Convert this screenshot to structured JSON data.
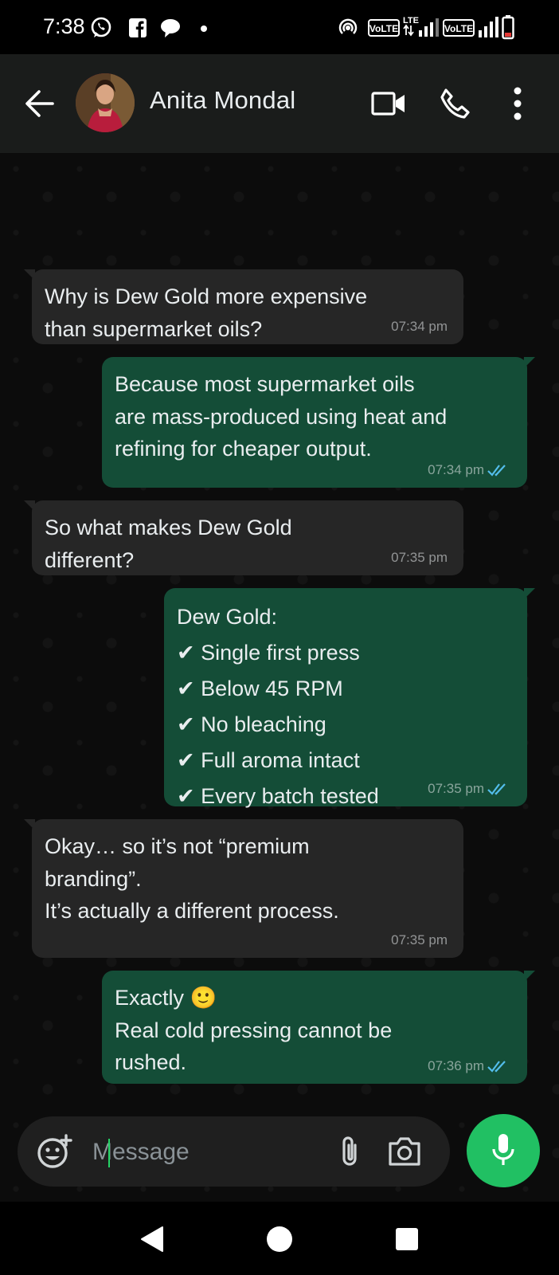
{
  "status_bar": {
    "time": "7:38",
    "left_icons": [
      "whatsapp-icon",
      "facebook-icon",
      "chat-bubble-icon",
      "dot-icon"
    ],
    "right_icons": [
      "hotspot-icon",
      "volte-1-icon",
      "lte-signal-icon",
      "volte-2-icon",
      "signal-icon",
      "battery-icon"
    ],
    "volte_label": "VoLTE",
    "lte_label": "LTE"
  },
  "header": {
    "contact_name": "Anita Mondal",
    "icons": [
      "back-arrow-icon",
      "avatar",
      "video-call-icon",
      "voice-call-icon",
      "more-options-icon"
    ]
  },
  "messages": [
    {
      "direction": "incoming",
      "text": "Why is Dew Gold more expensive\nthan supermarket oils?",
      "time": "07:34 pm"
    },
    {
      "direction": "outgoing",
      "text": "Because most supermarket oils\nare mass-produced using heat and\nrefining for cheaper output.",
      "time": "07:34 pm",
      "status": "read"
    },
    {
      "direction": "incoming",
      "text": "So what makes Dew Gold\ndifferent?",
      "time": "07:35 pm"
    },
    {
      "direction": "outgoing",
      "text": "Dew Gold:\n✔ Single first press\n✔ Below 45 RPM\n✔ No bleaching\n✔ Full aroma intact\n✔ Every batch tested",
      "time": "07:35 pm",
      "status": "read"
    },
    {
      "direction": "incoming",
      "text": "Okay… so it’s not “premium\nbranding”.\nIt’s actually a different process.",
      "time": "07:35 pm"
    },
    {
      "direction": "outgoing",
      "text": "Exactly 🙂\nReal cold pressing cannot be\nrushed.",
      "time": "07:36 pm",
      "status": "read"
    }
  ],
  "composer": {
    "placeholder": "Message",
    "value": "",
    "icons": [
      "emoji-sticker-icon",
      "attach-icon",
      "camera-icon",
      "mic-icon"
    ]
  },
  "colors": {
    "incoming_bubble": "#262626",
    "outgoing_bubble": "#144d37",
    "read_ticks": "#53bdeb",
    "mic_button": "#21c063"
  },
  "nav_bar": {
    "icons": [
      "back-triangle-icon",
      "home-circle-icon",
      "recents-square-icon"
    ]
  }
}
